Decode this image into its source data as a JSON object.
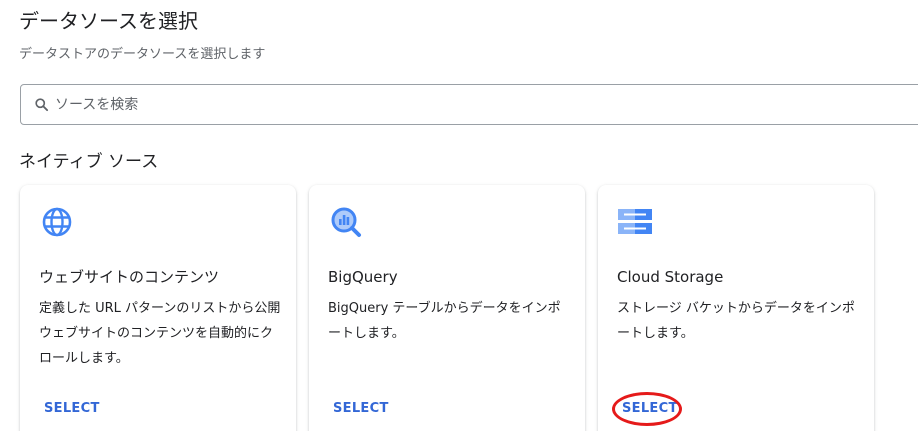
{
  "header": {
    "title": "データソースを選択",
    "subtitle": "データストアのデータソースを選択します"
  },
  "search": {
    "icon": "search-icon",
    "placeholder": "ソースを検索"
  },
  "section": {
    "title": "ネイティブ ソース"
  },
  "cards": [
    {
      "icon": "globe-icon",
      "title": "ウェブサイトのコンテンツ",
      "description": "定義した URL パターンのリストから公開ウェブサイトのコンテンツを自動的にクロールします。",
      "select_label": "SELECT"
    },
    {
      "icon": "bigquery-icon",
      "title": "BigQuery",
      "description": "BigQuery テーブルからデータをインポートします。",
      "select_label": "SELECT"
    },
    {
      "icon": "storage-icon",
      "title": "Cloud Storage",
      "description": "ストレージ バケットからデータをインポートします。",
      "select_label": "SELECT"
    }
  ],
  "colors": {
    "accent": "#3367d6",
    "icon_blue": "#4285f4",
    "highlight": "#e51a1a"
  }
}
